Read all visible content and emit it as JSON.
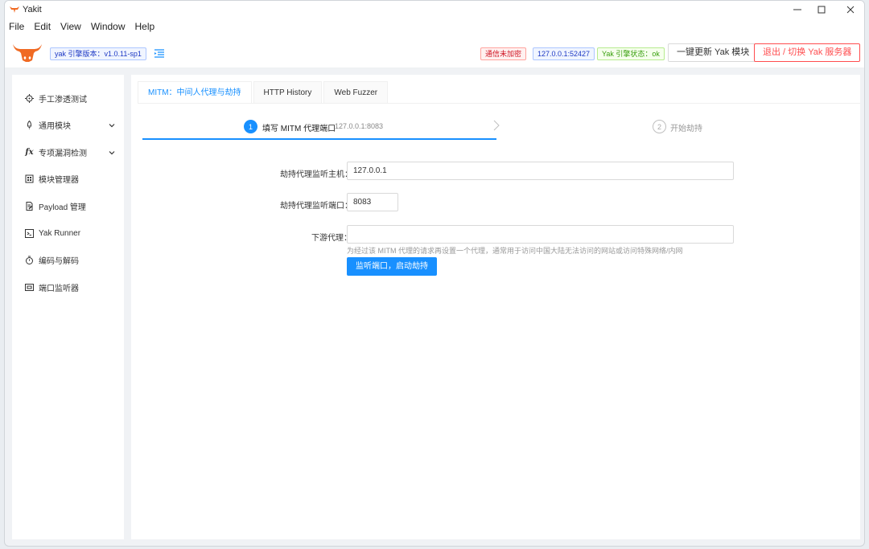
{
  "window": {
    "title": "Yakit"
  },
  "menubar": {
    "items": [
      "File",
      "Edit",
      "View",
      "Window",
      "Help"
    ]
  },
  "header": {
    "version_tag": "yak 引擎版本：v1.0.11-sp1",
    "comm_tag": "通信未加密",
    "addr_tag": "127.0.0.1:52427",
    "status_tag": "Yak 引擎状态：ok",
    "update_button": "一键更新 Yak 模块",
    "exit_button": "退出 / 切换 Yak 服务器"
  },
  "sidebar": {
    "items": [
      {
        "label": "手工渗透测试",
        "icon": "aim-icon",
        "expandable": false
      },
      {
        "label": "通用模块",
        "icon": "rocket-icon",
        "expandable": true
      },
      {
        "label": "专项漏洞检测",
        "icon": "function-icon",
        "expandable": true
      },
      {
        "label": "模块管理器",
        "icon": "app-store-icon",
        "expandable": false
      },
      {
        "label": "Payload 管理",
        "icon": "file-edit-icon",
        "expandable": false
      },
      {
        "label": "Yak Runner",
        "icon": "code-icon",
        "expandable": false
      },
      {
        "label": "编码与解码",
        "icon": "stopwatch-icon",
        "expandable": false
      },
      {
        "label": "端口监听器",
        "icon": "port-icon",
        "expandable": false
      }
    ]
  },
  "tabs": [
    "MITM：中间人代理与劫持",
    "HTTP History",
    "Web Fuzzer"
  ],
  "active_tab": 0,
  "steps": [
    {
      "index": "1",
      "title": "填写 MITM 代理端口",
      "description": "127.0.0.1:8083",
      "status": "process"
    },
    {
      "index": "2",
      "title": "开始劫持",
      "description": "",
      "status": "wait"
    }
  ],
  "form": {
    "host_label": "劫持代理监听主机：",
    "host_value": "127.0.0.1",
    "port_label": "劫持代理监听端口：",
    "port_value": "8083",
    "downstream_label": "下游代理：",
    "downstream_value": "",
    "downstream_help": "为经过该 MITM 代理的请求再设置一个代理，通常用于访问中国大陆无法访问的网站或访问特殊网络/内网",
    "submit_button": "监听端口，启动劫持"
  },
  "colors": {
    "primary": "#1890ff",
    "logo": "#f06a23"
  }
}
